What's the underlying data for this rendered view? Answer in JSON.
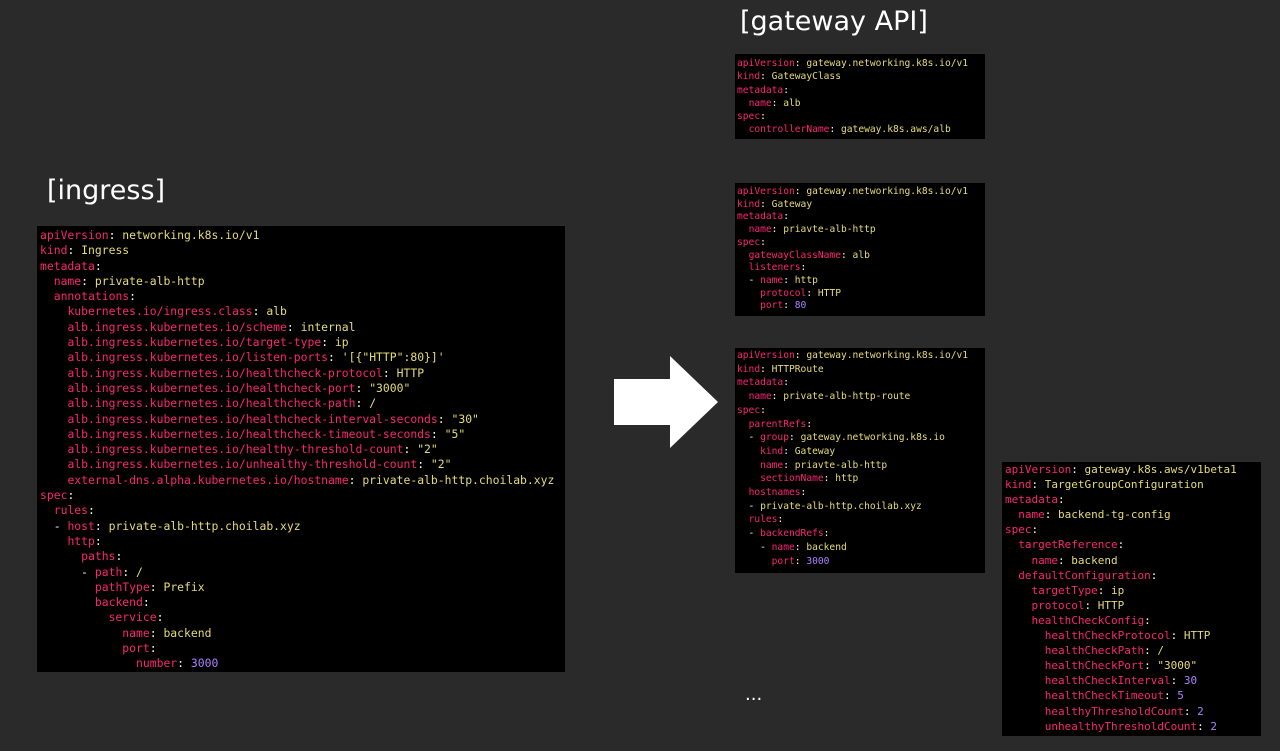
{
  "headings": {
    "ingress": "[ingress]",
    "gateway_api": "[gateway API]"
  },
  "ellipsis": "...",
  "arrow_icon": "right-arrow",
  "code_colors": {
    "background": "#000000",
    "key": "#f92672",
    "value": "#e6db74",
    "number": "#ae81ff",
    "punctuation": "#f8f8f2"
  },
  "code_blocks": {
    "ingress": [
      [
        "",
        "apiVersion",
        "networking.k8s.io/v1",
        false
      ],
      [
        "",
        "kind",
        "Ingress",
        false
      ],
      [
        "",
        "metadata",
        "",
        false
      ],
      [
        "  ",
        "name",
        "private-alb-http",
        false
      ],
      [
        "  ",
        "annotations",
        "",
        false
      ],
      [
        "    ",
        "kubernetes.io/ingress.class",
        "alb",
        false
      ],
      [
        "    ",
        "alb.ingress.kubernetes.io/scheme",
        "internal",
        false
      ],
      [
        "    ",
        "alb.ingress.kubernetes.io/target-type",
        "ip",
        false
      ],
      [
        "    ",
        "alb.ingress.kubernetes.io/listen-ports",
        "'[{\"HTTP\":80}]'",
        false
      ],
      [
        "    ",
        "alb.ingress.kubernetes.io/healthcheck-protocol",
        "HTTP",
        false
      ],
      [
        "    ",
        "alb.ingress.kubernetes.io/healthcheck-port",
        "\"3000\"",
        false
      ],
      [
        "    ",
        "alb.ingress.kubernetes.io/healthcheck-path",
        "/",
        false
      ],
      [
        "    ",
        "alb.ingress.kubernetes.io/healthcheck-interval-seconds",
        "\"30\"",
        false
      ],
      [
        "    ",
        "alb.ingress.kubernetes.io/healthcheck-timeout-seconds",
        "\"5\"",
        false
      ],
      [
        "    ",
        "alb.ingress.kubernetes.io/healthy-threshold-count",
        "\"2\"",
        false
      ],
      [
        "    ",
        "alb.ingress.kubernetes.io/unhealthy-threshold-count",
        "\"2\"",
        false
      ],
      [
        "    ",
        "external-dns.alpha.kubernetes.io/hostname",
        "private-alb-http.choilab.xyz",
        false
      ],
      [
        "",
        "spec",
        "",
        false
      ],
      [
        "  ",
        "rules",
        "",
        false
      ],
      [
        "  - ",
        "host",
        "private-alb-http.choilab.xyz",
        false
      ],
      [
        "    ",
        "http",
        "",
        false
      ],
      [
        "      ",
        "paths",
        "",
        false
      ],
      [
        "      - ",
        "path",
        "/",
        false
      ],
      [
        "        ",
        "pathType",
        "Prefix",
        false
      ],
      [
        "        ",
        "backend",
        "",
        false
      ],
      [
        "          ",
        "service",
        "",
        false
      ],
      [
        "            ",
        "name",
        "backend",
        false
      ],
      [
        "            ",
        "port",
        "",
        false
      ],
      [
        "              ",
        "number",
        "3000",
        true
      ]
    ],
    "gatewayclass": [
      [
        "",
        "apiVersion",
        "gateway.networking.k8s.io/v1",
        false
      ],
      [
        "",
        "kind",
        "GatewayClass",
        false
      ],
      [
        "",
        "metadata",
        "",
        false
      ],
      [
        "  ",
        "name",
        "alb",
        false
      ],
      [
        "",
        "spec",
        "",
        false
      ],
      [
        "  ",
        "controllerName",
        "gateway.k8s.aws/alb",
        false
      ]
    ],
    "gateway": [
      [
        "",
        "apiVersion",
        "gateway.networking.k8s.io/v1",
        false
      ],
      [
        "",
        "kind",
        "Gateway",
        false
      ],
      [
        "",
        "metadata",
        "",
        false
      ],
      [
        "  ",
        "name",
        "priavte-alb-http",
        false
      ],
      [
        "",
        "spec",
        "",
        false
      ],
      [
        "  ",
        "gatewayClassName",
        "alb",
        false
      ],
      [
        "  ",
        "listeners",
        "",
        false
      ],
      [
        "  - ",
        "name",
        "http",
        false
      ],
      [
        "    ",
        "protocol",
        "HTTP",
        false
      ],
      [
        "    ",
        "port",
        "80",
        true
      ]
    ],
    "httproute": [
      [
        "",
        "apiVersion",
        "gateway.networking.k8s.io/v1",
        false
      ],
      [
        "",
        "kind",
        "HTTPRoute",
        false
      ],
      [
        "",
        "metadata",
        "",
        false
      ],
      [
        "  ",
        "name",
        "private-alb-http-route",
        false
      ],
      [
        "",
        "spec",
        "",
        false
      ],
      [
        "  ",
        "parentRefs",
        "",
        false
      ],
      [
        "  - ",
        "group",
        "gateway.networking.k8s.io",
        false
      ],
      [
        "    ",
        "kind",
        "Gateway",
        false
      ],
      [
        "    ",
        "name",
        "priavte-alb-http",
        false
      ],
      [
        "    ",
        "sectionName",
        "http",
        false
      ],
      [
        "  ",
        "hostnames",
        "",
        false
      ],
      [
        "  - ",
        "",
        "private-alb-http.choilab.xyz",
        false
      ],
      [
        "  ",
        "rules",
        "",
        false
      ],
      [
        "  - ",
        "backendRefs",
        "",
        false
      ],
      [
        "    - ",
        "name",
        "backend",
        false
      ],
      [
        "      ",
        "port",
        "3000",
        true
      ]
    ],
    "targetgroupconfiguration": [
      [
        "",
        "apiVersion",
        "gateway.k8s.aws/v1beta1",
        false
      ],
      [
        "",
        "kind",
        "TargetGroupConfiguration",
        false
      ],
      [
        "",
        "metadata",
        "",
        false
      ],
      [
        "  ",
        "name",
        "backend-tg-config",
        false
      ],
      [
        "",
        "spec",
        "",
        false
      ],
      [
        "  ",
        "targetReference",
        "",
        false
      ],
      [
        "    ",
        "name",
        "backend",
        false
      ],
      [
        "  ",
        "defaultConfiguration",
        "",
        false
      ],
      [
        "    ",
        "targetType",
        "ip",
        false
      ],
      [
        "    ",
        "protocol",
        "HTTP",
        false
      ],
      [
        "    ",
        "healthCheckConfig",
        "",
        false
      ],
      [
        "      ",
        "healthCheckProtocol",
        "HTTP",
        false
      ],
      [
        "      ",
        "healthCheckPath",
        "/",
        false
      ],
      [
        "      ",
        "healthCheckPort",
        "\"3000\"",
        false
      ],
      [
        "      ",
        "healthCheckInterval",
        "30",
        true
      ],
      [
        "      ",
        "healthCheckTimeout",
        "5",
        true
      ],
      [
        "      ",
        "healthyThresholdCount",
        "2",
        true
      ],
      [
        "      ",
        "unhealthyThresholdCount",
        "2",
        true
      ]
    ]
  }
}
